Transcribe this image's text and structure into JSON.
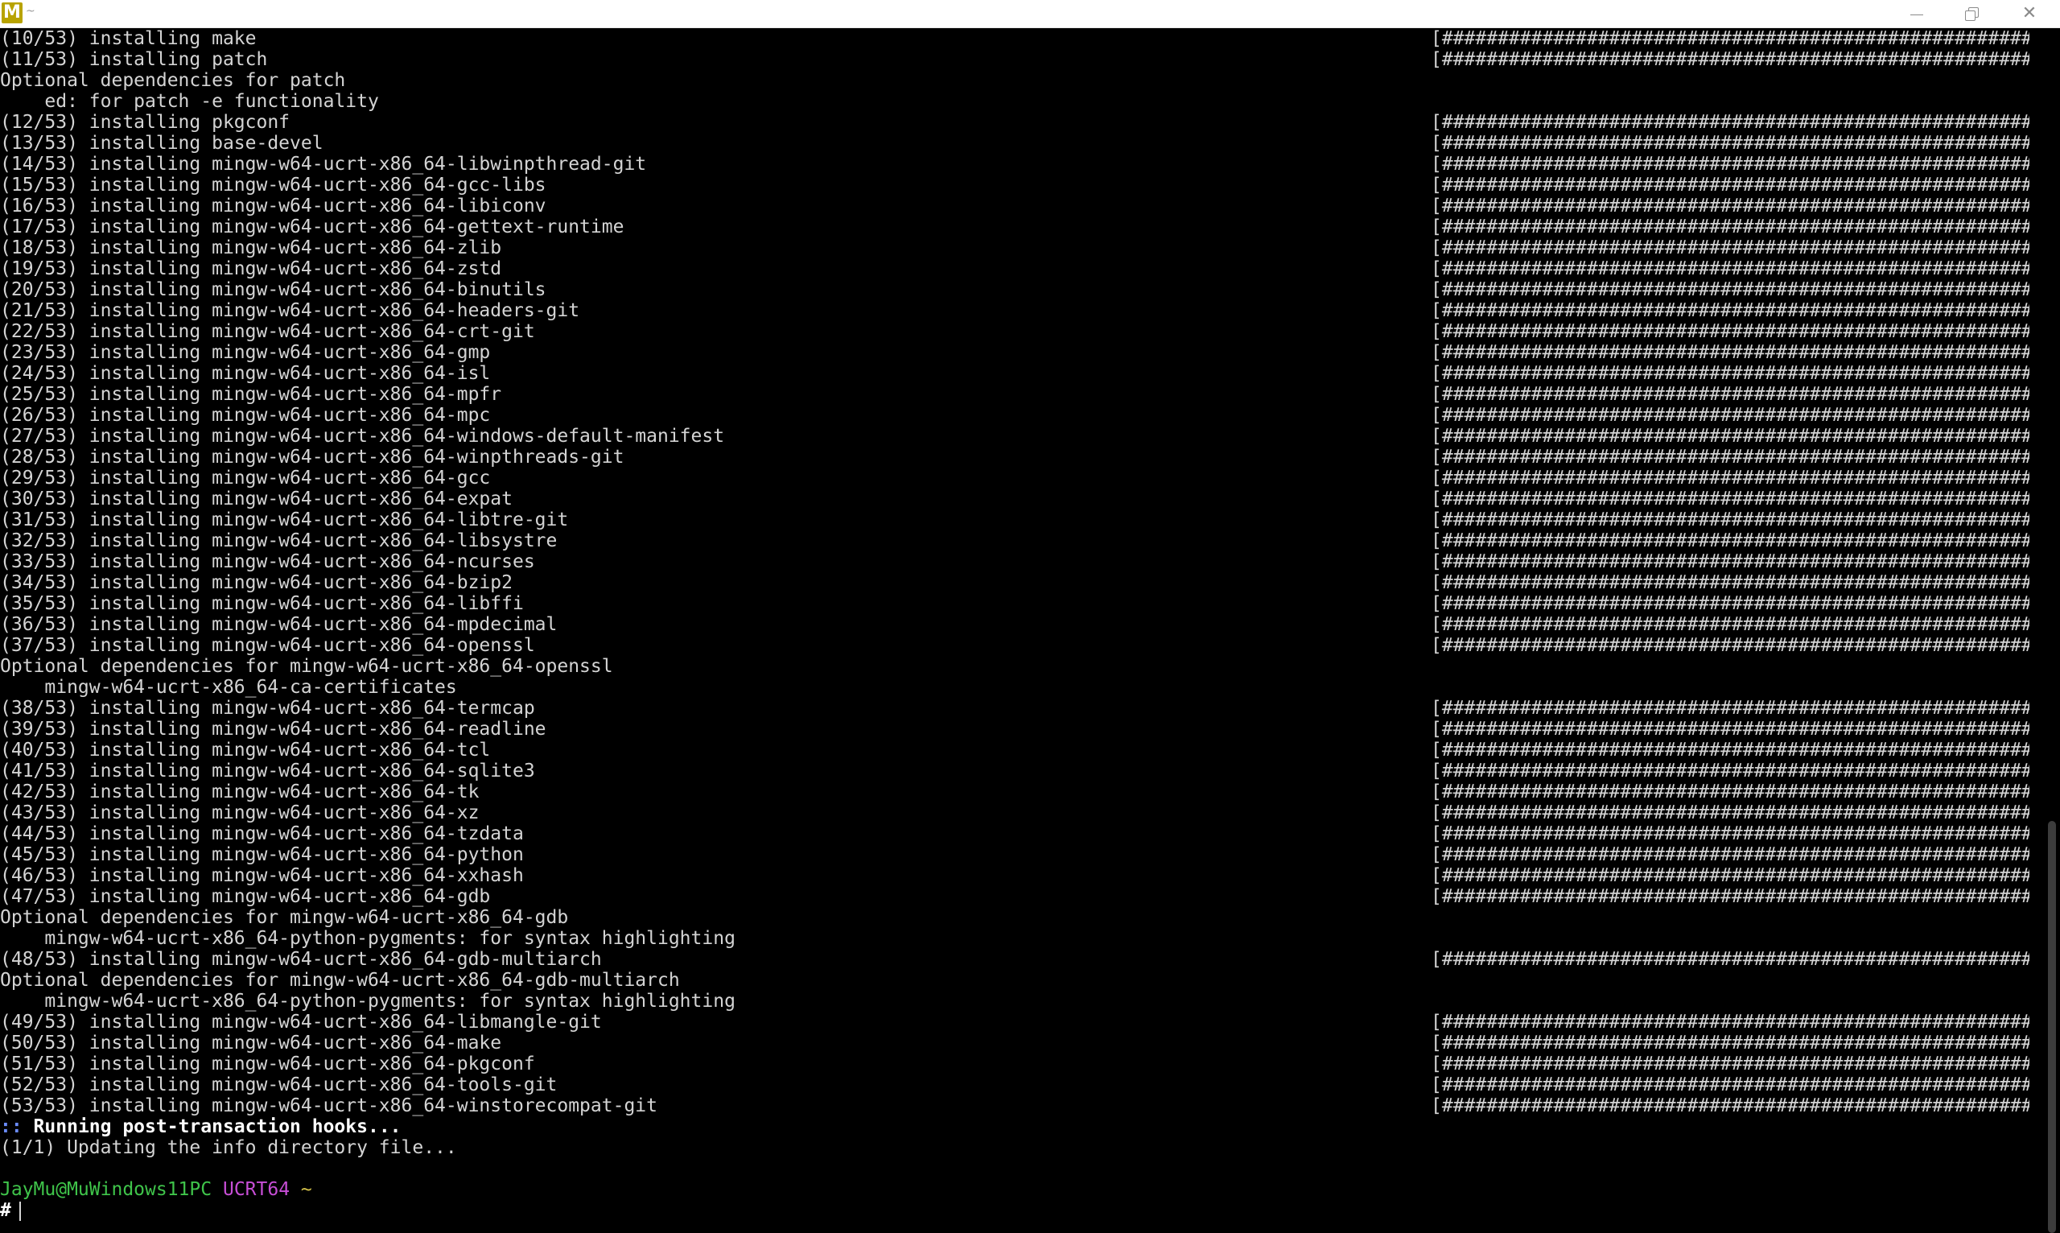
{
  "window": {
    "title": "~",
    "app_icon_letter": "M",
    "icons": {
      "minimize": "minimize-icon",
      "maximize": "restore-icon",
      "close": "close-icon",
      "close_glyph": "✕"
    }
  },
  "terminal": {
    "colors": {
      "background": "#000000",
      "text": "#d4d4d4",
      "prompt_user": "#3fc44a",
      "prompt_env": "#c74ed6",
      "prompt_dir": "#d4c24a",
      "hook_prefix": "#6b8cff"
    },
    "progress_bar": "[###########################################################",
    "lines": [
      {
        "text": "(10/53) installing make",
        "bar": true
      },
      {
        "text": "(11/53) installing patch",
        "bar": true
      },
      {
        "text": "Optional dependencies for patch",
        "bar": false
      },
      {
        "text": "    ed: for patch -e functionality",
        "bar": false
      },
      {
        "text": "(12/53) installing pkgconf",
        "bar": true
      },
      {
        "text": "(13/53) installing base-devel",
        "bar": true
      },
      {
        "text": "(14/53) installing mingw-w64-ucrt-x86_64-libwinpthread-git",
        "bar": true
      },
      {
        "text": "(15/53) installing mingw-w64-ucrt-x86_64-gcc-libs",
        "bar": true
      },
      {
        "text": "(16/53) installing mingw-w64-ucrt-x86_64-libiconv",
        "bar": true
      },
      {
        "text": "(17/53) installing mingw-w64-ucrt-x86_64-gettext-runtime",
        "bar": true
      },
      {
        "text": "(18/53) installing mingw-w64-ucrt-x86_64-zlib",
        "bar": true
      },
      {
        "text": "(19/53) installing mingw-w64-ucrt-x86_64-zstd",
        "bar": true
      },
      {
        "text": "(20/53) installing mingw-w64-ucrt-x86_64-binutils",
        "bar": true
      },
      {
        "text": "(21/53) installing mingw-w64-ucrt-x86_64-headers-git",
        "bar": true
      },
      {
        "text": "(22/53) installing mingw-w64-ucrt-x86_64-crt-git",
        "bar": true
      },
      {
        "text": "(23/53) installing mingw-w64-ucrt-x86_64-gmp",
        "bar": true
      },
      {
        "text": "(24/53) installing mingw-w64-ucrt-x86_64-isl",
        "bar": true
      },
      {
        "text": "(25/53) installing mingw-w64-ucrt-x86_64-mpfr",
        "bar": true
      },
      {
        "text": "(26/53) installing mingw-w64-ucrt-x86_64-mpc",
        "bar": true
      },
      {
        "text": "(27/53) installing mingw-w64-ucrt-x86_64-windows-default-manifest",
        "bar": true
      },
      {
        "text": "(28/53) installing mingw-w64-ucrt-x86_64-winpthreads-git",
        "bar": true
      },
      {
        "text": "(29/53) installing mingw-w64-ucrt-x86_64-gcc",
        "bar": true
      },
      {
        "text": "(30/53) installing mingw-w64-ucrt-x86_64-expat",
        "bar": true
      },
      {
        "text": "(31/53) installing mingw-w64-ucrt-x86_64-libtre-git",
        "bar": true
      },
      {
        "text": "(32/53) installing mingw-w64-ucrt-x86_64-libsystre",
        "bar": true
      },
      {
        "text": "(33/53) installing mingw-w64-ucrt-x86_64-ncurses",
        "bar": true
      },
      {
        "text": "(34/53) installing mingw-w64-ucrt-x86_64-bzip2",
        "bar": true
      },
      {
        "text": "(35/53) installing mingw-w64-ucrt-x86_64-libffi",
        "bar": true
      },
      {
        "text": "(36/53) installing mingw-w64-ucrt-x86_64-mpdecimal",
        "bar": true
      },
      {
        "text": "(37/53) installing mingw-w64-ucrt-x86_64-openssl",
        "bar": true
      },
      {
        "text": "Optional dependencies for mingw-w64-ucrt-x86_64-openssl",
        "bar": false
      },
      {
        "text": "    mingw-w64-ucrt-x86_64-ca-certificates",
        "bar": false
      },
      {
        "text": "(38/53) installing mingw-w64-ucrt-x86_64-termcap",
        "bar": true
      },
      {
        "text": "(39/53) installing mingw-w64-ucrt-x86_64-readline",
        "bar": true
      },
      {
        "text": "(40/53) installing mingw-w64-ucrt-x86_64-tcl",
        "bar": true
      },
      {
        "text": "(41/53) installing mingw-w64-ucrt-x86_64-sqlite3",
        "bar": true
      },
      {
        "text": "(42/53) installing mingw-w64-ucrt-x86_64-tk",
        "bar": true
      },
      {
        "text": "(43/53) installing mingw-w64-ucrt-x86_64-xz",
        "bar": true
      },
      {
        "text": "(44/53) installing mingw-w64-ucrt-x86_64-tzdata",
        "bar": true
      },
      {
        "text": "(45/53) installing mingw-w64-ucrt-x86_64-python",
        "bar": true
      },
      {
        "text": "(46/53) installing mingw-w64-ucrt-x86_64-xxhash",
        "bar": true
      },
      {
        "text": "(47/53) installing mingw-w64-ucrt-x86_64-gdb",
        "bar": true
      },
      {
        "text": "Optional dependencies for mingw-w64-ucrt-x86_64-gdb",
        "bar": false
      },
      {
        "text": "    mingw-w64-ucrt-x86_64-python-pygments: for syntax highlighting",
        "bar": false
      },
      {
        "text": "(48/53) installing mingw-w64-ucrt-x86_64-gdb-multiarch",
        "bar": true
      },
      {
        "text": "Optional dependencies for mingw-w64-ucrt-x86_64-gdb-multiarch",
        "bar": false
      },
      {
        "text": "    mingw-w64-ucrt-x86_64-python-pygments: for syntax highlighting",
        "bar": false
      },
      {
        "text": "(49/53) installing mingw-w64-ucrt-x86_64-libmangle-git",
        "bar": true
      },
      {
        "text": "(50/53) installing mingw-w64-ucrt-x86_64-make",
        "bar": true
      },
      {
        "text": "(51/53) installing mingw-w64-ucrt-x86_64-pkgconf",
        "bar": true
      },
      {
        "text": "(52/53) installing mingw-w64-ucrt-x86_64-tools-git",
        "bar": true
      },
      {
        "text": "(53/53) installing mingw-w64-ucrt-x86_64-winstorecompat-git",
        "bar": true
      }
    ],
    "hooks": {
      "prefix": "::",
      "message": " Running post-transaction hooks...",
      "step": "(1/1) Updating the info directory file..."
    },
    "prompt": {
      "user_host": "JayMu@MuWindows11PC",
      "env": "UCRT64",
      "dir": "~",
      "symbol": "#"
    }
  }
}
